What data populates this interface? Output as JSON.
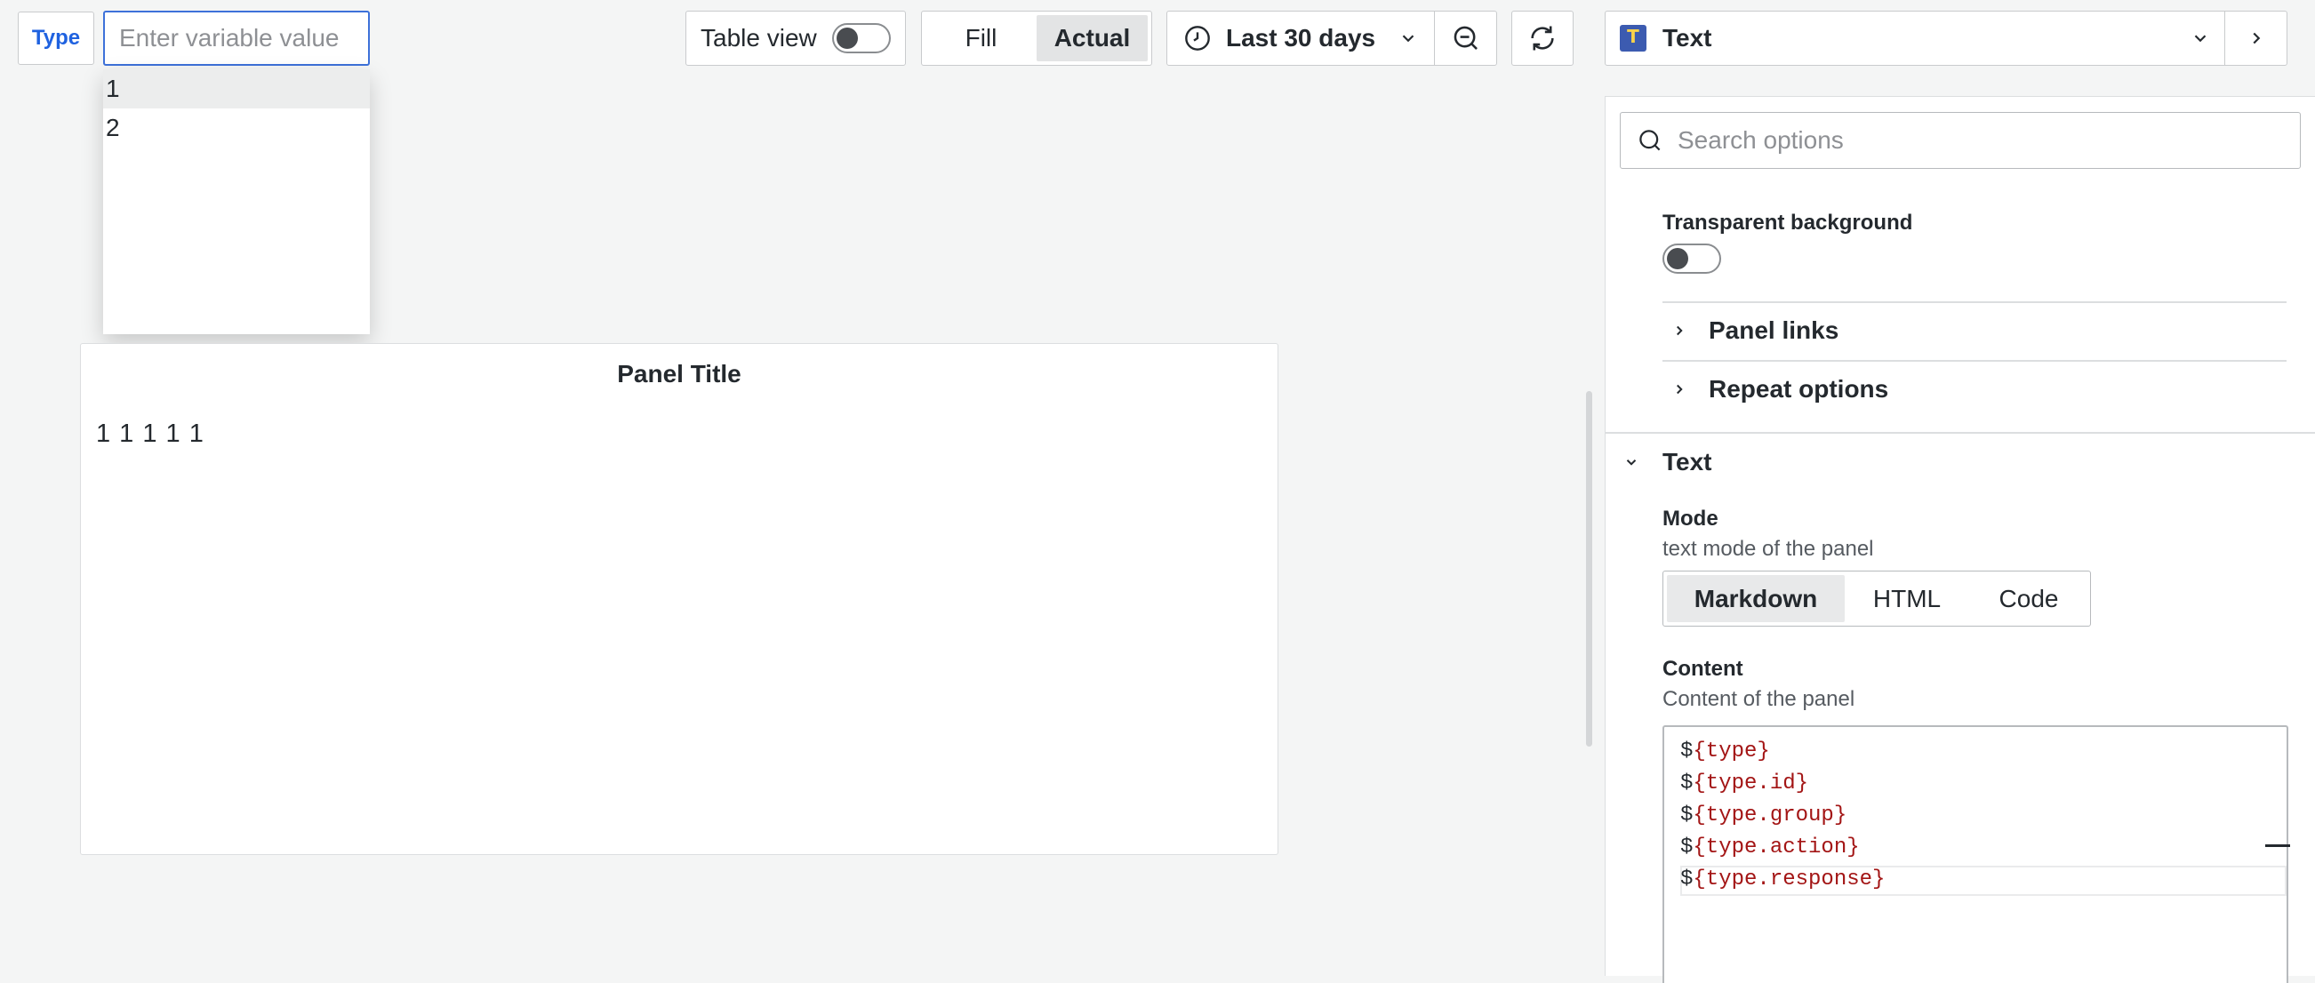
{
  "variable": {
    "label": "Type",
    "placeholder": "Enter variable value",
    "options": [
      "1",
      "2"
    ]
  },
  "toolbar": {
    "table_view_label": "Table view",
    "fill_label": "Fill",
    "actual_label": "Actual",
    "time_range": "Last 30 days"
  },
  "viz": {
    "name": "Text",
    "logo_letter": "T"
  },
  "panel": {
    "title": "Panel Title",
    "content": "1 1 1 1 1"
  },
  "options": {
    "search_placeholder": "Search options",
    "transparent_label": "Transparent background",
    "panel_links": "Panel links",
    "repeat_options": "Repeat options",
    "text_section": "Text",
    "mode_label": "Mode",
    "mode_desc": "text mode of the panel",
    "modes": [
      "Markdown",
      "HTML",
      "Code"
    ],
    "content_label": "Content",
    "content_desc": "Content of the panel",
    "content_lines": [
      {
        "prefix": "$",
        "expr": "{type}"
      },
      {
        "prefix": "$",
        "expr": "{type.id}"
      },
      {
        "prefix": "$",
        "expr": "{type.group}"
      },
      {
        "prefix": "$",
        "expr": "{type.action}"
      },
      {
        "prefix": "$",
        "expr": "{type.response}"
      }
    ]
  },
  "colors": {
    "accent": "#1f62e0",
    "code_var": "#a31515",
    "viz_logo_bg": "#3c5bb0"
  }
}
